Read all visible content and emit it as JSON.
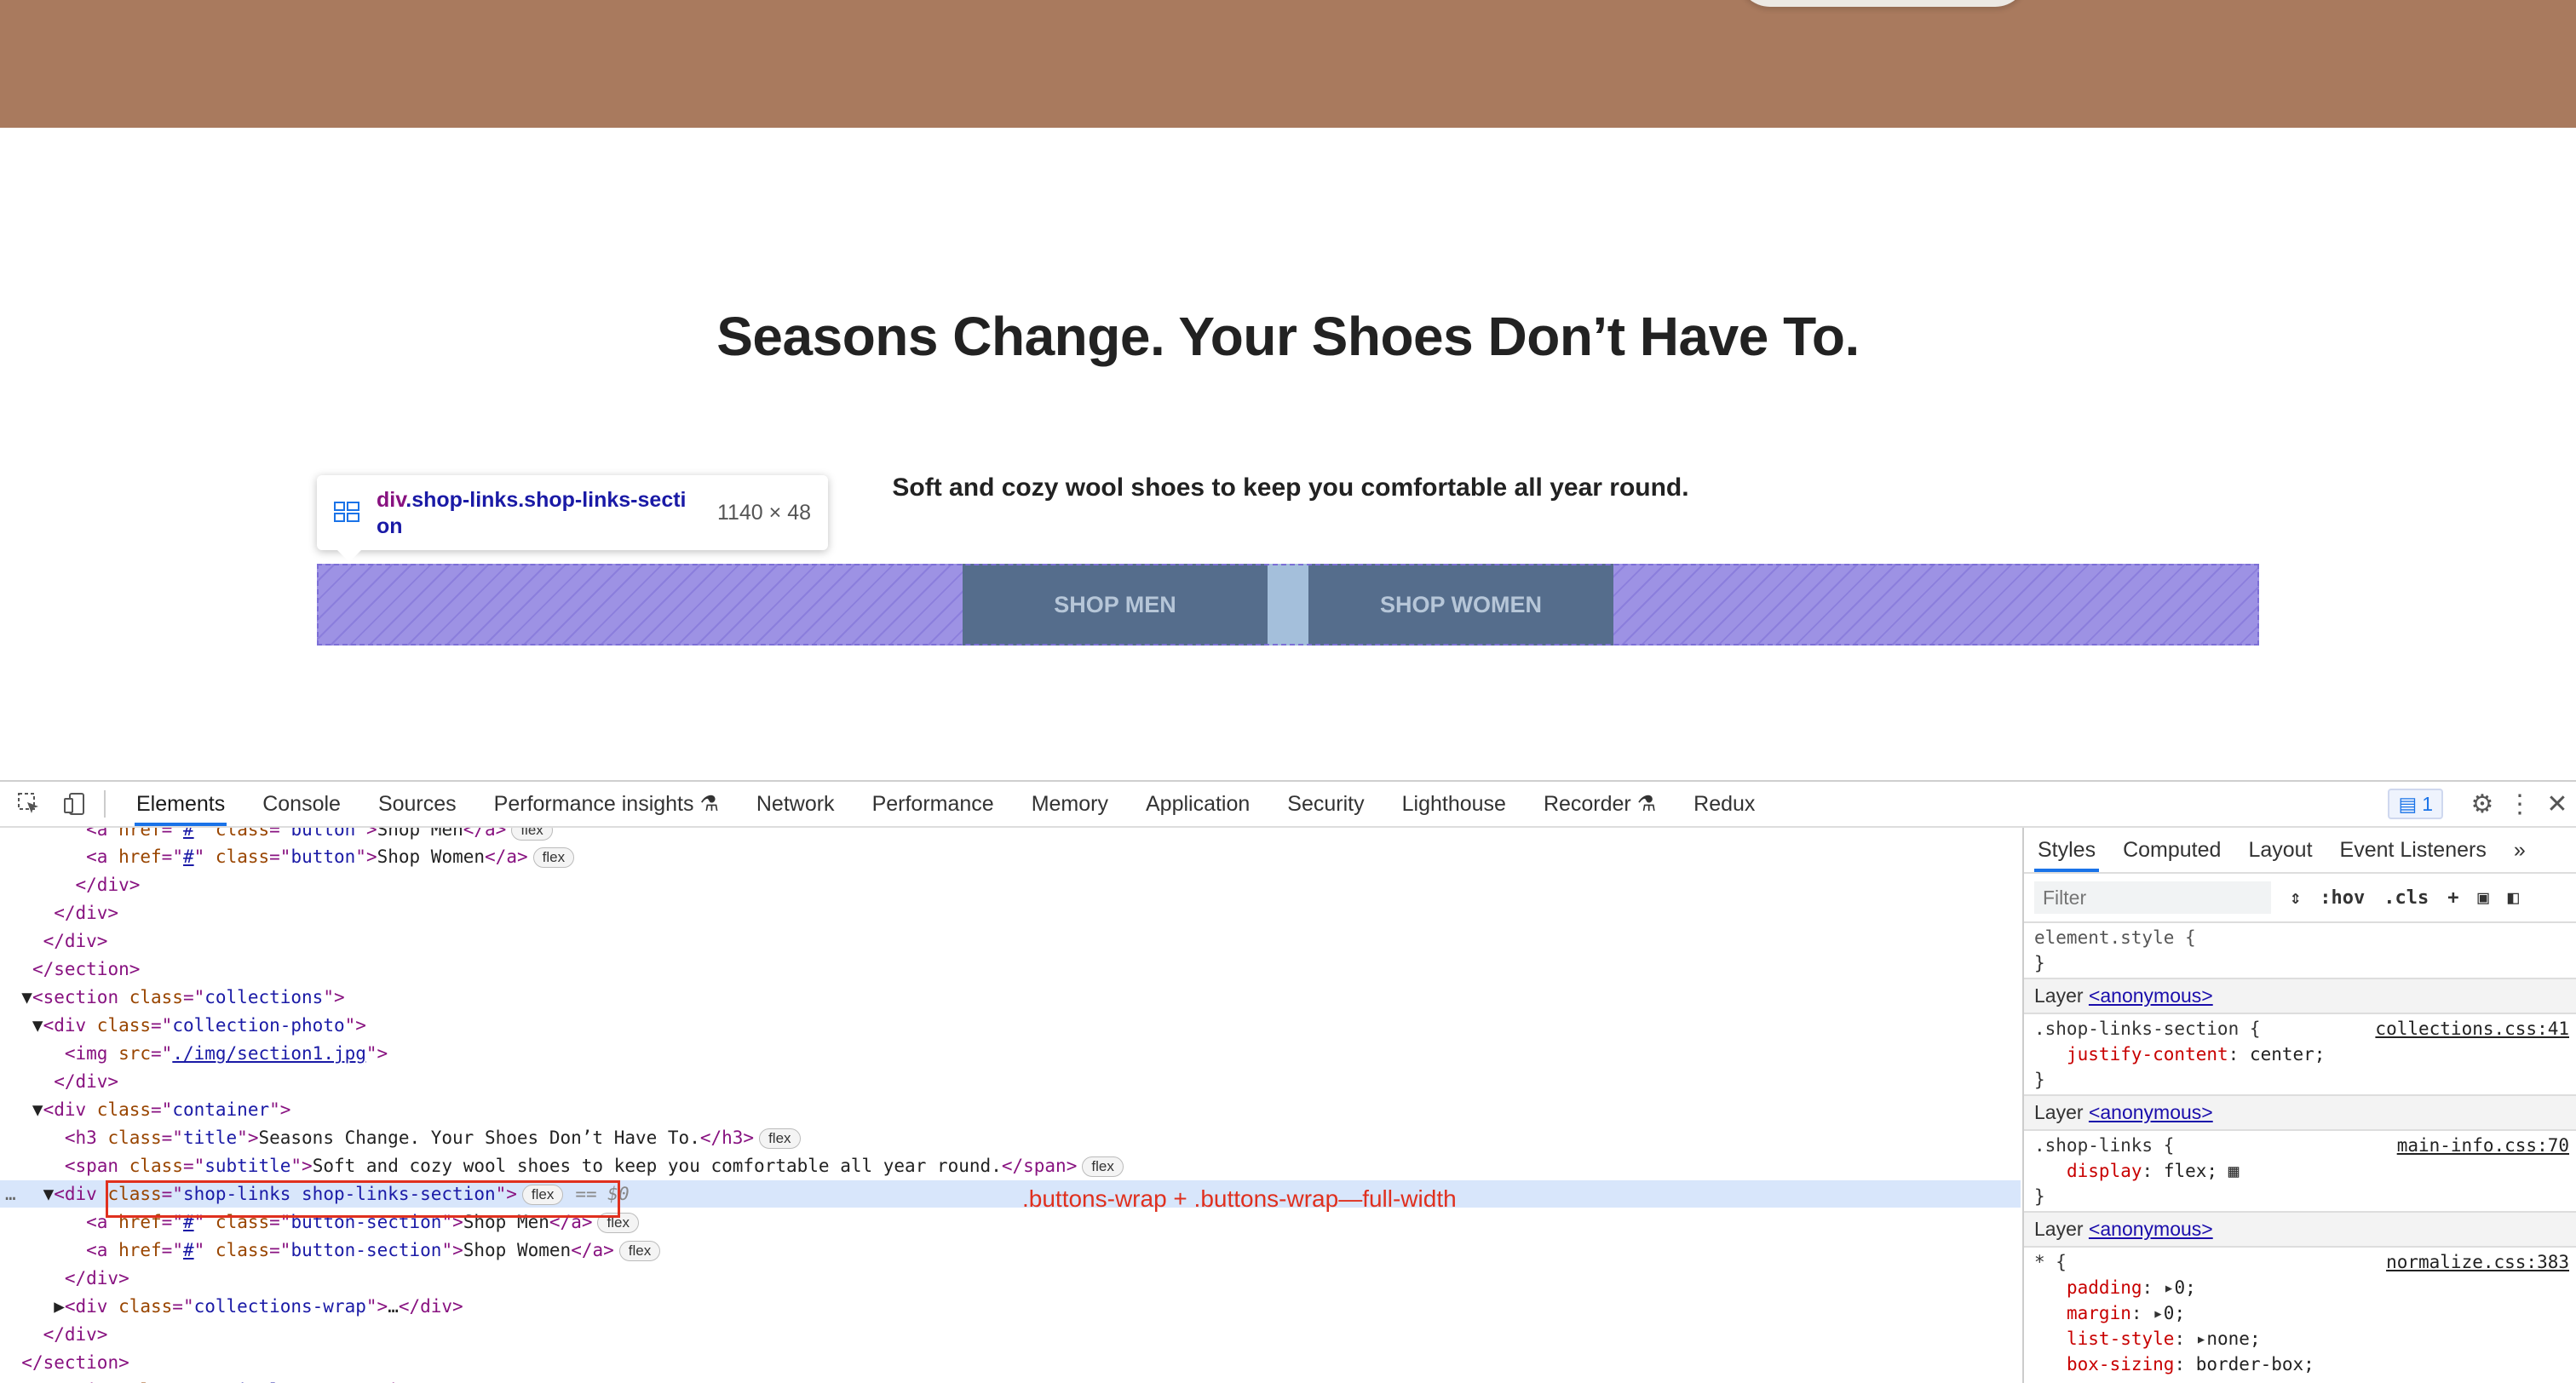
{
  "page": {
    "title": "Seasons Change. Your Shoes Don’t Have To.",
    "subtitle": "Soft and cozy wool shoes to keep you comfortable all year round.",
    "buttons": [
      "SHOP MEN",
      "SHOP WOMEN"
    ]
  },
  "tooltip": {
    "tag": "div",
    "classes": ".shop-links.shop-links-secti on",
    "size": "1140 × 48"
  },
  "devtools": {
    "tabs": [
      "Elements",
      "Console",
      "Sources",
      "Performance insights",
      "Network",
      "Performance",
      "Memory",
      "Application",
      "Security",
      "Lighthouse",
      "Recorder",
      "Redux"
    ],
    "issues_count": "1",
    "annotation": ".buttons-wrap + .buttons-wrap—full-width",
    "styles_tabs": [
      "Styles",
      "Computed",
      "Layout",
      "Event Listeners"
    ],
    "filter_placeholder": "Filter",
    "hov": ":hov",
    "cls": ".cls",
    "element_style": "element.style {",
    "close_brace": "}",
    "layer_label": "Layer",
    "layer_link": "<anonymous>",
    "rules": [
      {
        "selector": ".shop-links-section {",
        "source": "collections.css:41",
        "prop": "justify-content",
        "value": "center;"
      },
      {
        "selector": ".shop-links {",
        "source": "main-info.css:70",
        "prop": "display",
        "value": "flex;"
      },
      {
        "selector": "* {",
        "source": "normalize.css:383",
        "props": [
          [
            "padding",
            "0;"
          ],
          [
            "margin",
            "0;"
          ],
          [
            "list-style",
            "none;"
          ],
          [
            "box-sizing",
            "border-box;"
          ]
        ]
      }
    ]
  }
}
